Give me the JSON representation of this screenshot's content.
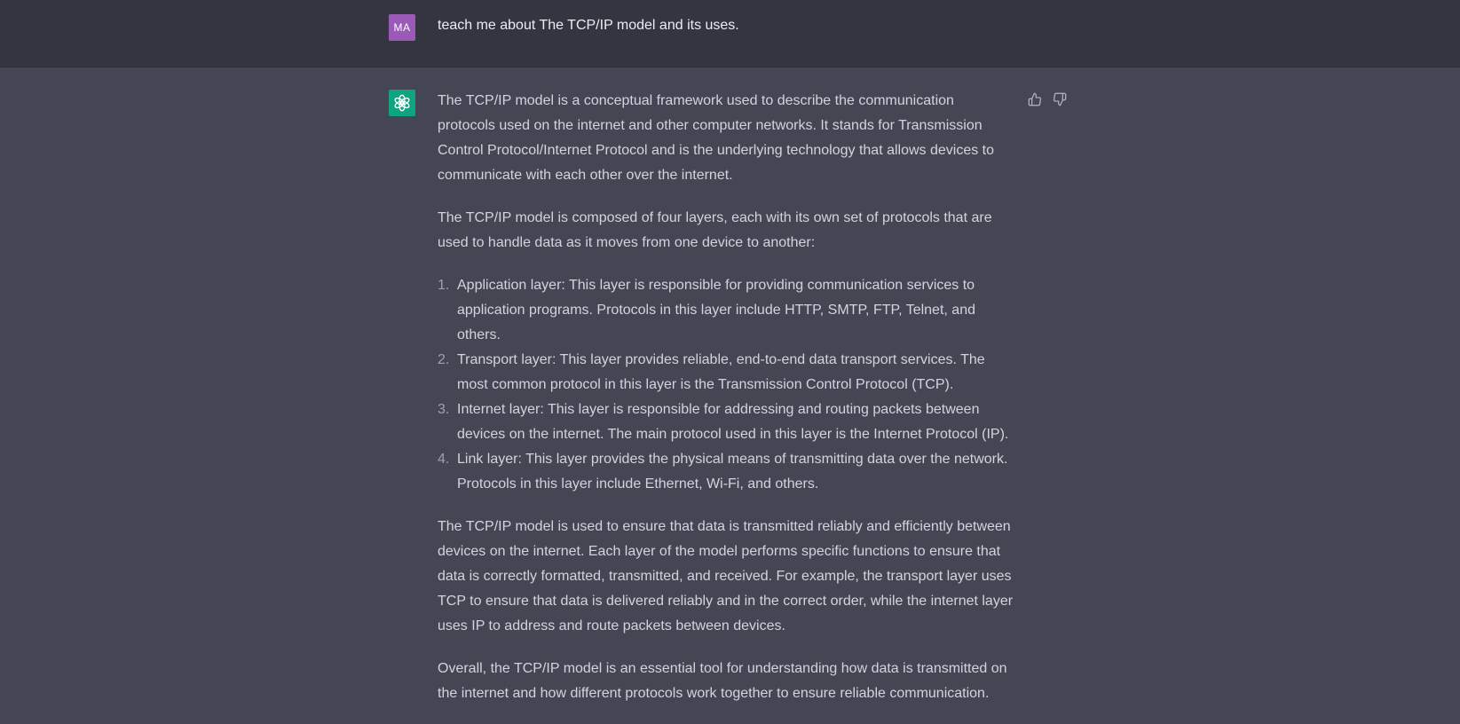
{
  "conversation": {
    "user": {
      "avatar_initials": "MA",
      "avatar_color": "#9c5ab8",
      "message": "teach me about The TCP/IP model and its uses."
    },
    "assistant": {
      "avatar_icon": "openai-logo-icon",
      "avatar_color": "#10a37f",
      "paragraphs_before": [
        "The TCP/IP model is a conceptual framework used to describe the communication protocols used on the internet and other computer networks. It stands for Transmission Control Protocol/Internet Protocol and is the underlying technology that allows devices to communicate with each other over the internet.",
        "The TCP/IP model is composed of four layers, each with its own set of protocols that are used to handle data as it moves from one device to another:"
      ],
      "list": [
        {
          "num": "1.",
          "text": "Application layer: This layer is responsible for providing communication services to application programs. Protocols in this layer include HTTP, SMTP, FTP, Telnet, and others."
        },
        {
          "num": "2.",
          "text": "Transport layer: This layer provides reliable, end-to-end data transport services. The most common protocol in this layer is the Transmission Control Protocol (TCP)."
        },
        {
          "num": "3.",
          "text": "Internet layer: This layer is responsible for addressing and routing packets between devices on the internet. The main protocol used in this layer is the Internet Protocol (IP)."
        },
        {
          "num": "4.",
          "text": "Link layer: This layer provides the physical means of transmitting data over the network. Protocols in this layer include Ethernet, Wi-Fi, and others."
        }
      ],
      "paragraphs_after": [
        "The TCP/IP model is used to ensure that data is transmitted reliably and efficiently between devices on the internet. Each layer of the model performs specific functions to ensure that data is correctly formatted, transmitted, and received. For example, the transport layer uses TCP to ensure that data is delivered reliably and in the correct order, while the internet layer uses IP to address and route packets between devices.",
        "Overall, the TCP/IP model is an essential tool for understanding how data is transmitted on the internet and how different protocols work together to ensure reliable communication."
      ],
      "feedback_icons": [
        "thumbs-up-icon",
        "thumbs-down-icon"
      ]
    }
  },
  "colors": {
    "user_row_bg": "#343541",
    "assistant_row_bg": "#444654",
    "text": "#d1d5db"
  }
}
